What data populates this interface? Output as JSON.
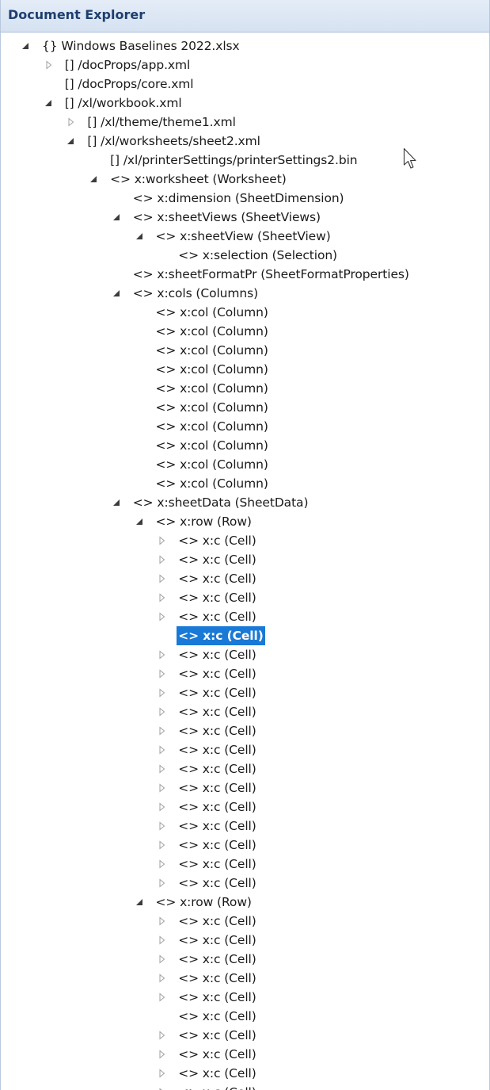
{
  "panel": {
    "title": "Document Explorer"
  },
  "tree": [
    {
      "label": "{} Windows Baselines 2022.xlsx",
      "depth": 0,
      "expander": "expanded"
    },
    {
      "label": "[] /docProps/app.xml",
      "depth": 1,
      "expander": "collapsed"
    },
    {
      "label": "[] /docProps/core.xml",
      "depth": 1,
      "expander": "none"
    },
    {
      "label": "[] /xl/workbook.xml",
      "depth": 1,
      "expander": "expanded"
    },
    {
      "label": "[] /xl/theme/theme1.xml",
      "depth": 2,
      "expander": "collapsed"
    },
    {
      "label": "[] /xl/worksheets/sheet2.xml",
      "depth": 2,
      "expander": "expanded"
    },
    {
      "label": "[] /xl/printerSettings/printerSettings2.bin",
      "depth": 3,
      "expander": "none"
    },
    {
      "label": "<> x:worksheet (Worksheet)",
      "depth": 3,
      "expander": "expanded"
    },
    {
      "label": "<> x:dimension (SheetDimension)",
      "depth": 4,
      "expander": "none"
    },
    {
      "label": "<> x:sheetViews (SheetViews)",
      "depth": 4,
      "expander": "expanded"
    },
    {
      "label": "<> x:sheetView (SheetView)",
      "depth": 5,
      "expander": "expanded"
    },
    {
      "label": "<> x:selection (Selection)",
      "depth": 6,
      "expander": "none"
    },
    {
      "label": "<> x:sheetFormatPr (SheetFormatProperties)",
      "depth": 4,
      "expander": "none"
    },
    {
      "label": "<> x:cols (Columns)",
      "depth": 4,
      "expander": "expanded"
    },
    {
      "label": "<> x:col (Column)",
      "depth": 5,
      "expander": "none"
    },
    {
      "label": "<> x:col (Column)",
      "depth": 5,
      "expander": "none"
    },
    {
      "label": "<> x:col (Column)",
      "depth": 5,
      "expander": "none"
    },
    {
      "label": "<> x:col (Column)",
      "depth": 5,
      "expander": "none"
    },
    {
      "label": "<> x:col (Column)",
      "depth": 5,
      "expander": "none"
    },
    {
      "label": "<> x:col (Column)",
      "depth": 5,
      "expander": "none"
    },
    {
      "label": "<> x:col (Column)",
      "depth": 5,
      "expander": "none"
    },
    {
      "label": "<> x:col (Column)",
      "depth": 5,
      "expander": "none"
    },
    {
      "label": "<> x:col (Column)",
      "depth": 5,
      "expander": "none"
    },
    {
      "label": "<> x:col (Column)",
      "depth": 5,
      "expander": "none"
    },
    {
      "label": "<> x:sheetData (SheetData)",
      "depth": 4,
      "expander": "expanded"
    },
    {
      "label": "<> x:row (Row)",
      "depth": 5,
      "expander": "expanded"
    },
    {
      "label": "<> x:c (Cell)",
      "depth": 6,
      "expander": "collapsed"
    },
    {
      "label": "<> x:c (Cell)",
      "depth": 6,
      "expander": "collapsed"
    },
    {
      "label": "<> x:c (Cell)",
      "depth": 6,
      "expander": "collapsed"
    },
    {
      "label": "<> x:c (Cell)",
      "depth": 6,
      "expander": "collapsed"
    },
    {
      "label": "<> x:c (Cell)",
      "depth": 6,
      "expander": "collapsed"
    },
    {
      "label": "<> x:c (Cell)",
      "depth": 6,
      "expander": "none",
      "selected": true
    },
    {
      "label": "<> x:c (Cell)",
      "depth": 6,
      "expander": "collapsed"
    },
    {
      "label": "<> x:c (Cell)",
      "depth": 6,
      "expander": "collapsed"
    },
    {
      "label": "<> x:c (Cell)",
      "depth": 6,
      "expander": "collapsed"
    },
    {
      "label": "<> x:c (Cell)",
      "depth": 6,
      "expander": "collapsed"
    },
    {
      "label": "<> x:c (Cell)",
      "depth": 6,
      "expander": "collapsed"
    },
    {
      "label": "<> x:c (Cell)",
      "depth": 6,
      "expander": "collapsed"
    },
    {
      "label": "<> x:c (Cell)",
      "depth": 6,
      "expander": "collapsed"
    },
    {
      "label": "<> x:c (Cell)",
      "depth": 6,
      "expander": "collapsed"
    },
    {
      "label": "<> x:c (Cell)",
      "depth": 6,
      "expander": "collapsed"
    },
    {
      "label": "<> x:c (Cell)",
      "depth": 6,
      "expander": "collapsed"
    },
    {
      "label": "<> x:c (Cell)",
      "depth": 6,
      "expander": "collapsed"
    },
    {
      "label": "<> x:c (Cell)",
      "depth": 6,
      "expander": "collapsed"
    },
    {
      "label": "<> x:c (Cell)",
      "depth": 6,
      "expander": "collapsed"
    },
    {
      "label": "<> x:row (Row)",
      "depth": 5,
      "expander": "expanded"
    },
    {
      "label": "<> x:c (Cell)",
      "depth": 6,
      "expander": "collapsed"
    },
    {
      "label": "<> x:c (Cell)",
      "depth": 6,
      "expander": "collapsed"
    },
    {
      "label": "<> x:c (Cell)",
      "depth": 6,
      "expander": "collapsed"
    },
    {
      "label": "<> x:c (Cell)",
      "depth": 6,
      "expander": "collapsed"
    },
    {
      "label": "<> x:c (Cell)",
      "depth": 6,
      "expander": "collapsed"
    },
    {
      "label": "<> x:c (Cell)",
      "depth": 6,
      "expander": "none"
    },
    {
      "label": "<> x:c (Cell)",
      "depth": 6,
      "expander": "collapsed"
    },
    {
      "label": "<> x:c (Cell)",
      "depth": 6,
      "expander": "collapsed"
    },
    {
      "label": "<> x:c (Cell)",
      "depth": 6,
      "expander": "collapsed"
    },
    {
      "label": "<> x:c (Cell)",
      "depth": 6,
      "expander": "collapsed"
    }
  ],
  "icons": {
    "expanded": "expanded-triangle-icon",
    "collapsed": "collapsed-triangle-icon",
    "cursor": "mouse-pointer-icon"
  },
  "colors": {
    "header_bg": "#dbe5f3",
    "header_text": "#1e3f6e",
    "selection_bg": "#1979d6",
    "selection_text": "#ffffff",
    "expander_filled": "#3c3c3c",
    "expander_outline": "#a0a0a0"
  }
}
